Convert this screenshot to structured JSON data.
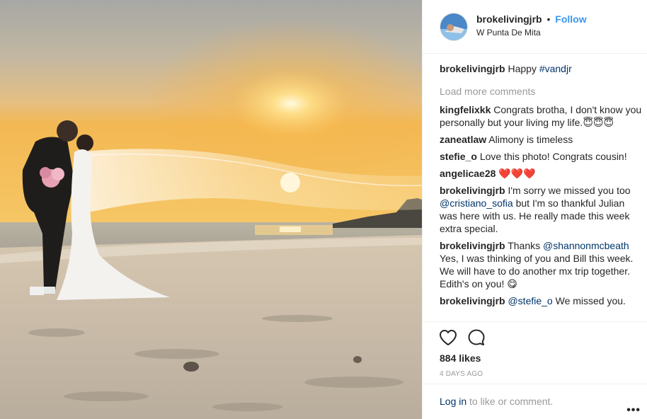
{
  "post": {
    "username": "brokelivingjrb",
    "dot": "•",
    "follow_label": "Follow",
    "location": "W Punta De Mita"
  },
  "caption": {
    "user": "brokelivingjrb",
    "text": "Happy ",
    "hashtag": "#vandjr"
  },
  "load_more": "Load more comments",
  "comments": [
    {
      "user": "kingfelixkk",
      "text": "Congrats brotha, I don't know you personally but your living my life.",
      "emoji": "😇😇😇"
    },
    {
      "user": "zaneatlaw",
      "text": "Alimony is timeless"
    },
    {
      "user": "stefie_o",
      "text": "Love this photo! Congrats cousin!"
    },
    {
      "user": "angelicae28",
      "emoji": "❤️❤️❤️"
    },
    {
      "user": "brokelivingjrb",
      "text_before": "I'm sorry we missed you too ",
      "mention": "@cristiano_sofia",
      "text_after": " but I'm so thankful Julian was here with us. He really made this week extra special."
    },
    {
      "user": "brokelivingjrb",
      "text_before": "Thanks ",
      "mention": "@shannonmcbeath",
      "text_after": " Yes, I was thinking of you and Bill this week. We will have to do another mx trip together. Edith's on you! ",
      "emoji": "😋"
    },
    {
      "user": "brokelivingjrb",
      "text_before": " ",
      "mention": "@stefie_o",
      "text_after": " We missed you."
    }
  ],
  "actions": {
    "like_icon": "heart-icon",
    "comment_icon": "comment-icon",
    "likes": "884 likes",
    "time": "4 DAYS AGO",
    "login_link": "Log in",
    "login_rest": " to like or comment.",
    "more_icon": "•••"
  },
  "colors": {
    "accent": "#3897f0",
    "link": "#003569",
    "muted": "#999999",
    "sky_top": "#a9a9a3",
    "sky_glow": "#f5b74c",
    "sand": "#cbbfaf"
  }
}
